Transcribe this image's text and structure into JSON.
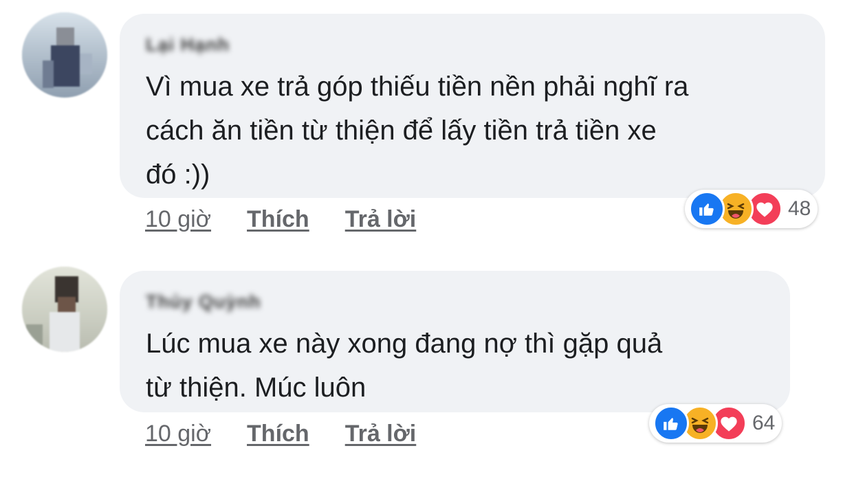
{
  "comments": [
    {
      "author": "Lại Hạnh",
      "text": "Vì mua xe trả góp thiếu tiền nền phải nghĩ ra\ncách ăn tiền từ thiện để lấy tiền trả tiền xe\nđó :))",
      "time": "10 giờ",
      "like_label": "Thích",
      "reply_label": "Trả lời",
      "reaction_count": "48",
      "reactions": [
        "like-icon",
        "haha-icon",
        "love-icon"
      ]
    },
    {
      "author": "Thủy Quỳnh",
      "text": "Lúc mua xe này xong đang nợ thì gặp quả\ntừ thiện. Múc luôn",
      "time": "10 giờ",
      "like_label": "Thích",
      "reply_label": "Trả lời",
      "reaction_count": "64",
      "reactions": [
        "like-icon",
        "haha-icon",
        "love-icon"
      ]
    }
  ],
  "colors": {
    "bubble": "#f0f2f5",
    "like": "#1877f2",
    "haha": "#f7b125",
    "love": "#f33e58",
    "meta_text": "#65676b"
  }
}
